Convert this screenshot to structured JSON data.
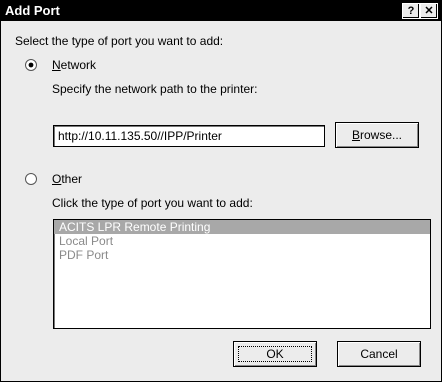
{
  "window": {
    "title": "Add Port",
    "help_label": "?",
    "close_label": "✕"
  },
  "intro_label": "Select the type of port you want to add:",
  "network": {
    "accel": "N",
    "label_rest": "etwork",
    "selected": true,
    "path_label": "Specify the network path to the printer:",
    "path_value": "http://10.11.135.50//IPP/Printer",
    "browse_accel": "B",
    "browse_rest": "rowse..."
  },
  "other": {
    "accel": "O",
    "label_rest": "ther",
    "selected": false,
    "list_label": "Click the type of port you want to add:",
    "port_types": [
      {
        "label": "ACITS LPR Remote Printing",
        "selected": true
      },
      {
        "label": "Local Port",
        "selected": false
      },
      {
        "label": "PDF Port",
        "selected": false
      }
    ]
  },
  "buttons": {
    "ok_label": "OK",
    "cancel_label": "Cancel"
  },
  "colors": {
    "dialog_bg": "#ececec",
    "titlebar_bg": "#000000",
    "selection_bg": "#a8a8a8",
    "disabled_text": "#8a8a8a"
  }
}
